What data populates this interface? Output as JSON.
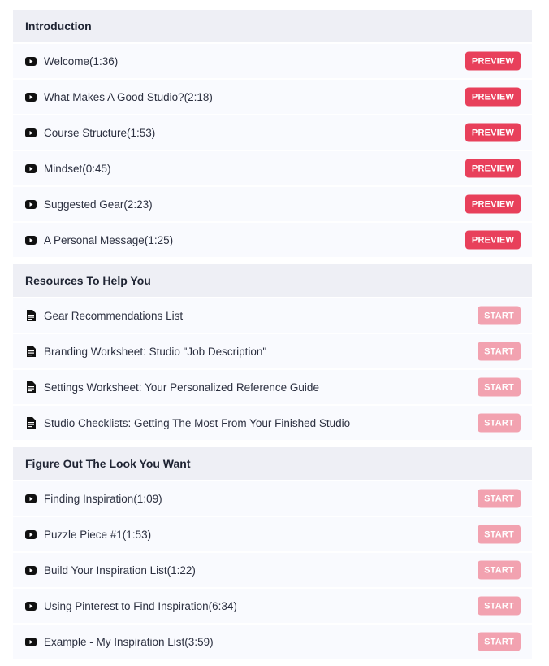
{
  "colors": {
    "preview_button": "#e8405b",
    "start_button": "#f2a2b0",
    "section_header_bg": "#eeeff5",
    "row_bg": "#f9fafe",
    "text": "#2c3040"
  },
  "sections": [
    {
      "title": "Introduction",
      "lectures": [
        {
          "icon": "youtube-icon",
          "title": "Welcome(1:36)",
          "action": "PREVIEW",
          "kind": "preview"
        },
        {
          "icon": "youtube-icon",
          "title": "What Makes A Good Studio?(2:18)",
          "action": "PREVIEW",
          "kind": "preview"
        },
        {
          "icon": "youtube-icon",
          "title": "Course Structure(1:53)",
          "action": "PREVIEW",
          "kind": "preview"
        },
        {
          "icon": "youtube-icon",
          "title": "Mindset(0:45)",
          "action": "PREVIEW",
          "kind": "preview"
        },
        {
          "icon": "youtube-icon",
          "title": "Suggested Gear(2:23)",
          "action": "PREVIEW",
          "kind": "preview"
        },
        {
          "icon": "youtube-icon",
          "title": "A Personal Message(1:25)",
          "action": "PREVIEW",
          "kind": "preview"
        }
      ]
    },
    {
      "title": "Resources To Help You",
      "lectures": [
        {
          "icon": "document-icon",
          "title": "Gear Recommendations List",
          "action": "START",
          "kind": "start"
        },
        {
          "icon": "document-icon",
          "title": "Branding Worksheet: Studio \"Job Description\"",
          "action": "START",
          "kind": "start"
        },
        {
          "icon": "document-icon",
          "title": "Settings Worksheet: Your Personalized Reference Guide",
          "action": "START",
          "kind": "start"
        },
        {
          "icon": "document-icon",
          "title": "Studio Checklists: Getting The Most From Your Finished Studio",
          "action": "START",
          "kind": "start"
        }
      ]
    },
    {
      "title": "Figure Out The Look You Want",
      "lectures": [
        {
          "icon": "youtube-icon",
          "title": "Finding Inspiration(1:09)",
          "action": "START",
          "kind": "start"
        },
        {
          "icon": "youtube-icon",
          "title": "Puzzle Piece #1(1:53)",
          "action": "START",
          "kind": "start"
        },
        {
          "icon": "youtube-icon",
          "title": "Build Your Inspiration List(1:22)",
          "action": "START",
          "kind": "start"
        },
        {
          "icon": "youtube-icon",
          "title": "Using Pinterest to Find Inspiration(6:34)",
          "action": "START",
          "kind": "start"
        },
        {
          "icon": "youtube-icon",
          "title": "Example - My Inspiration List(3:59)",
          "action": "START",
          "kind": "start"
        }
      ]
    }
  ]
}
